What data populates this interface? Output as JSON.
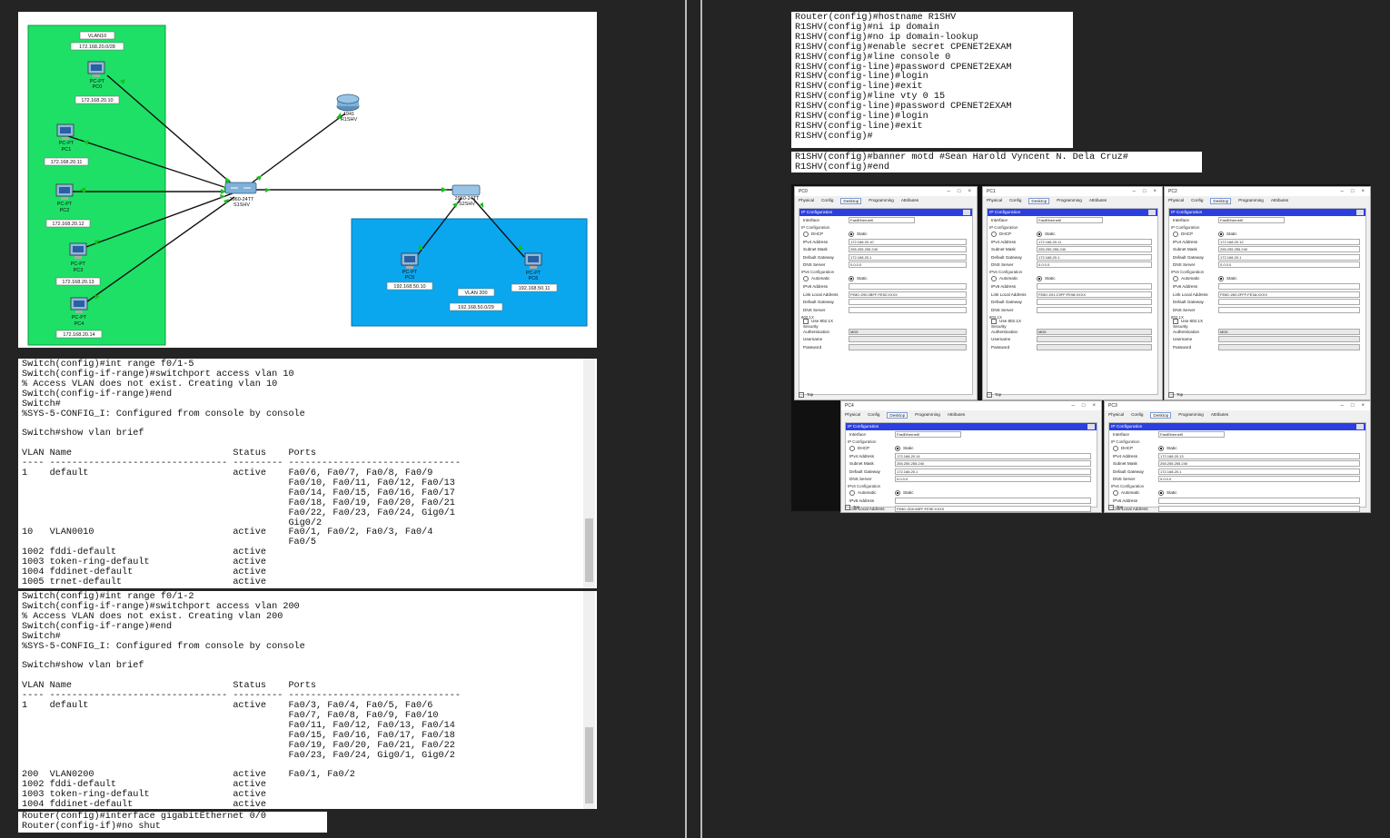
{
  "topology": {
    "vlan10_title": "VLAN10",
    "vlan10_network": "172.168.20.0/28",
    "vlan200_title": "VLAN 200",
    "vlan200_network": "192.168.50.0/29",
    "router": {
      "model": "1941",
      "name": "R1SHV"
    },
    "switch1": {
      "model": "2960-24TT",
      "name": "S1SHV"
    },
    "switch2": {
      "model": "2960-24TT",
      "name": "S2SHV"
    },
    "pcs_left": [
      {
        "type": "PC-PT",
        "name": "PC0",
        "ip": "172.168.20.10"
      },
      {
        "type": "PC-PT",
        "name": "PC1",
        "ip": "172.168.20.11"
      },
      {
        "type": "PC-PT",
        "name": "PC2",
        "ip": "172.168.20.12"
      },
      {
        "type": "PC-PT",
        "name": "PC3",
        "ip": "172.168.20.13"
      },
      {
        "type": "PC-PT",
        "name": "PC4",
        "ip": "172.168.20.14"
      }
    ],
    "pcs_right": [
      {
        "type": "PC-PT",
        "name": "PC5",
        "ip": "192.168.50.10"
      },
      {
        "type": "PC-PT",
        "name": "PC6",
        "ip": "192.168.50.11"
      }
    ]
  },
  "terminal_vlan10": "Switch(config)#int range f0/1-5\nSwitch(config-if-range)#switchport access vlan 10\n% Access VLAN does not exist. Creating vlan 10\nSwitch(config-if-range)#end\nSwitch#\n%SYS-5-CONFIG_I: Configured from console by console\n\nSwitch#show vlan brief\n\nVLAN Name                             Status    Ports\n---- -------------------------------- --------- -------------------------------\n1    default                          active    Fa0/6, Fa0/7, Fa0/8, Fa0/9\n                                                Fa0/10, Fa0/11, Fa0/12, Fa0/13\n                                                Fa0/14, Fa0/15, Fa0/16, Fa0/17\n                                                Fa0/18, Fa0/19, Fa0/20, Fa0/21\n                                                Fa0/22, Fa0/23, Fa0/24, Gig0/1\n                                                Gig0/2\n10   VLAN0010                         active    Fa0/1, Fa0/2, Fa0/3, Fa0/4\n                                                Fa0/5\n1002 fddi-default                     active\n1003 token-ring-default               active\n1004 fddinet-default                  active\n1005 trnet-default                    active",
  "terminal_vlan200": "Switch(config)#int range f0/1-2\nSwitch(config-if-range)#switchport access vlan 200\n% Access VLAN does not exist. Creating vlan 200\nSwitch(config-if-range)#end\nSwitch#\n%SYS-5-CONFIG_I: Configured from console by console\n\nSwitch#show vlan brief\n\nVLAN Name                             Status    Ports\n---- -------------------------------- --------- -------------------------------\n1    default                          active    Fa0/3, Fa0/4, Fa0/5, Fa0/6\n                                                Fa0/7, Fa0/8, Fa0/9, Fa0/10\n                                                Fa0/11, Fa0/12, Fa0/13, Fa0/14\n                                                Fa0/15, Fa0/16, Fa0/17, Fa0/18\n                                                Fa0/19, Fa0/20, Fa0/21, Fa0/22\n                                                Fa0/23, Fa0/24, Gig0/1, Gig0/2\n\n200  VLAN0200                         active    Fa0/1, Fa0/2\n1002 fddi-default                     active\n1003 token-ring-default               active\n1004 fddinet-default                  active\n1005 trnet-default                    active",
  "terminal_router_if": "Router(config)#interface gigabitEthernet 0/0\nRouter(config-if)#no shut",
  "terminal_router_config": "Router(config)#hostname R1SHV\nR1SHV(config)#ni ip domain\nR1SHV(config)#no ip domain-lookup\nR1SHV(config)#enable secret CPENET2EXAM\nR1SHV(config)#line console 0\nR1SHV(config-line)#password CPENET2EXAM\nR1SHV(config-line)#login\nR1SHV(config-line)#exit\nR1SHV(config)#line vty 0 15\nR1SHV(config-line)#password CPENET2EXAM\nR1SHV(config-line)#login\nR1SHV(config-line)#exit\nR1SHV(config)#",
  "terminal_banner": "R1SHV(config)#banner motd #Sean Harold Vyncent N. Dela Cruz#\nR1SHV(config)#end",
  "pc_window_common": {
    "tabs": [
      "Physical",
      "Config",
      "Desktop",
      "Programming",
      "Attributes"
    ],
    "ip_config_title": "IP Configuration",
    "interface_label": "Interface",
    "interface_value": "FastEthernet0",
    "ipv4_section": "IP Configuration",
    "dhcp": "DHCP",
    "static": "Static",
    "ipv4_label": "IPv4 Address",
    "mask_label": "Subnet Mask",
    "gateway_label": "Default Gateway",
    "dns_label": "DNS Server",
    "ipv6_section": "IPv6 Configuration",
    "auto": "Automatic",
    "ipv6_label": "IPv6 Address",
    "lla_label": "Link Local Address",
    "gw6_label": "Default Gateway",
    "dns6_label": "DNS Server",
    "dot1x_section": "802.1X",
    "use_dot1x": "Use 802.1X Security",
    "auth_label": "Authentication",
    "auth_value": "MD5",
    "user_label": "Username",
    "pass_label": "Password",
    "top": "Top"
  },
  "pc_windows": [
    {
      "title": "PC0",
      "ip": "172.168.20.10",
      "mask": "255.255.255.240",
      "gw": "172.168.20.1",
      "dns": "0.0.0.0",
      "lla": "FE80::290:2BFF:FE52:XXXX"
    },
    {
      "title": "PC1",
      "ip": "172.168.20.11",
      "mask": "255.255.255.240",
      "gw": "172.168.20.1",
      "dns": "0.0.0.0",
      "lla": "FE80::201:C9FF:FE98:XXXX"
    },
    {
      "title": "PC2",
      "ip": "172.168.20.12",
      "mask": "255.255.255.240",
      "gw": "172.168.20.1",
      "dns": "0.0.0.0",
      "lla": "FE80::260:2FFF:FE3A:XXXX"
    },
    {
      "title": "PC4",
      "ip": "172.168.20.14",
      "mask": "255.255.255.240",
      "gw": "172.168.20.1",
      "dns": "0.0.0.0",
      "lla": "FE80::2D0:58FF:FE9E:XXXX"
    },
    {
      "title": "PC3",
      "ip": "172.168.20.13",
      "mask": "255.255.255.240",
      "gw": "172.168.20.1",
      "dns": "0.0.0.0",
      "lla": ""
    }
  ]
}
